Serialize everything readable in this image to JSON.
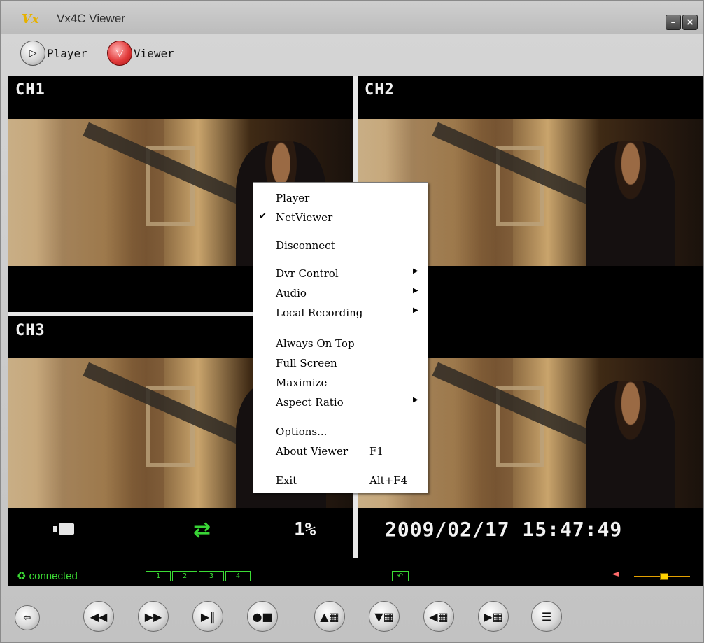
{
  "window": {
    "logo": "Vx",
    "title": "Vx4C Viewer",
    "minimize_glyph": "–",
    "close_glyph": "×"
  },
  "modes": {
    "player_label": "Player",
    "viewer_label": "Viewer",
    "player_icon": "play-icon",
    "viewer_icon": "viewer-icon"
  },
  "channels": [
    "CH1",
    "CH2",
    "CH3"
  ],
  "osd": {
    "percent": "1%",
    "datetime": "2009/02/17  15:47:49",
    "swap_glyph": "⇄"
  },
  "status": {
    "connection": "connected",
    "connection_icon": "♻",
    "channel_boxes": [
      "1",
      "2",
      "3",
      "4"
    ],
    "volume_level": 0.55,
    "accent_color": "#3cdc35"
  },
  "controls": [
    {
      "name": "back-button",
      "glyph": "⇦"
    },
    {
      "name": "rewind-button",
      "glyph": "◀◀"
    },
    {
      "name": "fast-forward-button",
      "glyph": "▶▶"
    },
    {
      "name": "play-pause-button",
      "glyph": "▶‖"
    },
    {
      "name": "stop-button",
      "glyph": "●■"
    },
    {
      "name": "channel-up-button",
      "glyph": "▲▦"
    },
    {
      "name": "channel-down-button",
      "glyph": "▼▦"
    },
    {
      "name": "channel-prev-button",
      "glyph": "◀▦"
    },
    {
      "name": "channel-next-button",
      "glyph": "▶▦"
    },
    {
      "name": "menu-button",
      "glyph": "☰"
    }
  ],
  "context_menu": {
    "items": [
      {
        "label": "Player",
        "checked": false,
        "submenu": false,
        "shortcut": ""
      },
      {
        "label": "NetViewer",
        "checked": true,
        "submenu": false,
        "shortcut": ""
      },
      {
        "label": "Disconnect",
        "checked": false,
        "submenu": false,
        "shortcut": ""
      },
      {
        "label": "Dvr Control",
        "checked": false,
        "submenu": true,
        "shortcut": ""
      },
      {
        "label": "Audio",
        "checked": false,
        "submenu": true,
        "shortcut": ""
      },
      {
        "label": "Local Recording",
        "checked": false,
        "submenu": true,
        "shortcut": ""
      },
      {
        "label": "Always On Top",
        "checked": false,
        "submenu": false,
        "shortcut": ""
      },
      {
        "label": "Full Screen",
        "checked": false,
        "submenu": false,
        "shortcut": ""
      },
      {
        "label": "Maximize",
        "checked": false,
        "submenu": false,
        "shortcut": ""
      },
      {
        "label": "Aspect Ratio",
        "checked": false,
        "submenu": true,
        "shortcut": ""
      },
      {
        "label": "Options...",
        "checked": false,
        "submenu": false,
        "shortcut": ""
      },
      {
        "label": "About Viewer",
        "checked": false,
        "submenu": false,
        "shortcut": "F1"
      },
      {
        "label": "Exit",
        "checked": false,
        "submenu": false,
        "shortcut": "Alt+F4"
      }
    ],
    "check_glyph": "✔",
    "arrow_glyph": "▶"
  }
}
